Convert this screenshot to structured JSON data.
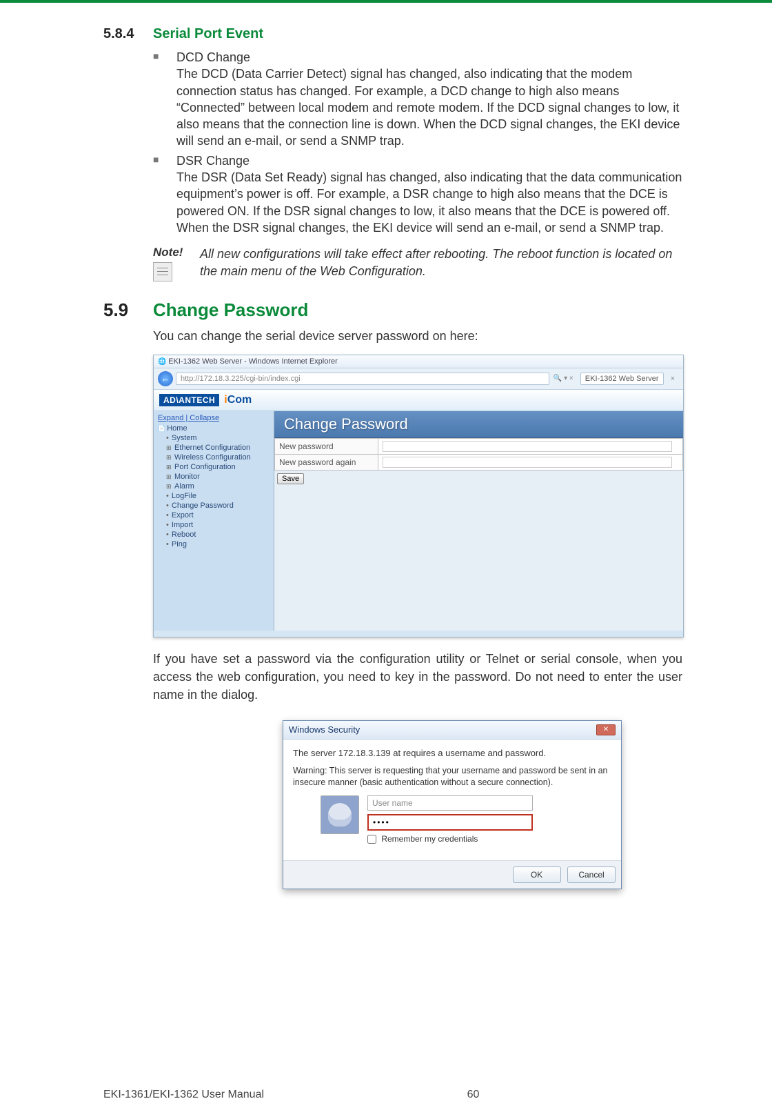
{
  "section584": {
    "num": "5.8.4",
    "title": "Serial Port Event"
  },
  "bullets": [
    {
      "title": "DCD Change",
      "body": "The DCD (Data Carrier Detect) signal has changed, also indicating that the modem connection status has changed. For example, a DCD change to high also means “Connected” between local modem and remote modem. If the DCD signal changes to low, it also means that the connection line is down. When the DCD signal changes, the EKI device will send an e-mail, or send a SNMP trap."
    },
    {
      "title": "DSR Change",
      "body": "The DSR (Data Set Ready) signal has changed, also indicating that the data communication equipment’s power is off. For example, a DSR change to high also means that the DCE is powered ON. If the DSR signal changes to low, it also means that the DCE is powered off. When the DSR signal changes, the EKI device will send an e-mail, or send a SNMP trap."
    }
  ],
  "note": {
    "label": "Note!",
    "text": "All new configurations will take effect after rebooting. The reboot function is located on the main menu of the Web Configuration."
  },
  "section59": {
    "num": "5.9",
    "title": "Change Password"
  },
  "intro59": "You can change the serial device server password on here:",
  "browser": {
    "windowTitle": "EKI-1362 Web Server - Windows Internet Explorer",
    "address": "http://172.18.3.225/cgi-bin/index.cgi",
    "searchHint": "🔍 ▾ ×",
    "refreshHint": "⭯",
    "tabLabel": "EKI-1362 Web Server",
    "brand": {
      "adv": "AD\\ANTECH",
      "icom": "iCom"
    },
    "toggles": "Expand | Collapse",
    "tree": {
      "home": "Home",
      "system": "System",
      "eth": "Ethernet Configuration",
      "wifi": "Wireless Configuration",
      "port": "Port Configuration",
      "monitor": "Monitor",
      "alarm": "Alarm",
      "logfile": "LogFile",
      "changepw": "Change Password",
      "export": "Export",
      "import": "Import",
      "reboot": "Reboot",
      "ping": "Ping"
    },
    "panelHead": "Change Password",
    "row1": "New password",
    "row2": "New password again",
    "saveBtn": "Save"
  },
  "after59": "If you have set a password via the configuration utility or Telnet or serial console, when you access the web configuration, you need to key in the password. Do not need to enter the user name in the dialog.",
  "winsec": {
    "title": "Windows Security",
    "msg": "The server 172.18.3.139 at  requires a username and password.",
    "warn": "Warning: This server is requesting that your username and password be sent in an insecure manner (basic authentication without a secure connection).",
    "userPlaceholder": "User name",
    "passValue": "••••",
    "remember": "Remember my credentials",
    "ok": "OK",
    "cancel": "Cancel"
  },
  "footer": {
    "left": "EKI-1361/EKI-1362 User Manual",
    "center": "60"
  }
}
